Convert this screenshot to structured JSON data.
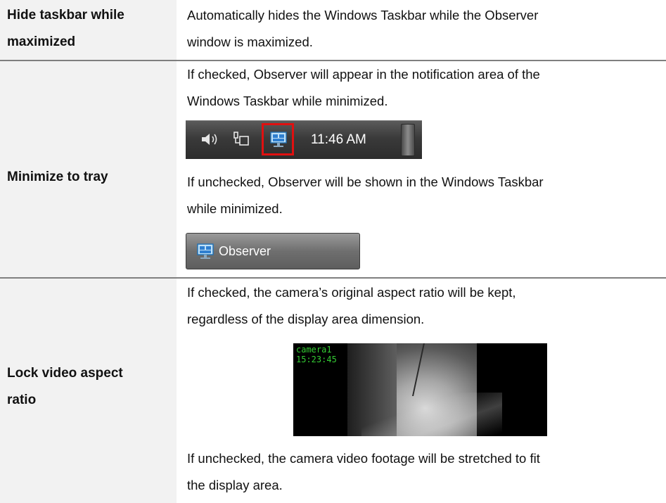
{
  "rows": [
    {
      "label_lines": [
        "Hide taskbar while",
        "maximized"
      ],
      "desc_lines": [
        "Automatically hides the Windows Taskbar while the Observer",
        "window is maximized."
      ]
    },
    {
      "label_lines": [
        "Minimize to tray"
      ],
      "desc_checked_lines": [
        "If checked, Observer will appear in the notification area of the",
        "Windows Taskbar while minimized."
      ],
      "tray_image": {
        "time": "11:46 AM",
        "icons": [
          "speaker-icon",
          "network-icon",
          "observer-tray-icon"
        ]
      },
      "desc_unchecked_lines": [
        "If unchecked, Observer will be shown in the Windows Taskbar",
        "while minimized."
      ],
      "taskbar_button": {
        "label": "Observer",
        "icon": "observer-icon"
      }
    },
    {
      "label_lines": [
        "Lock video aspect",
        "ratio"
      ],
      "desc_checked_lines": [
        "If checked, the camera’s original aspect ratio will be kept,",
        "regardless of the display area dimension."
      ],
      "camera_overlay": [
        "camera1",
        "15:23:45"
      ],
      "desc_unchecked_lines": [
        "If unchecked, the camera video footage will be stretched to fit",
        "the display area."
      ]
    }
  ],
  "colors": {
    "highlight_box": "#e01010",
    "label_bg": "#f2f2f2",
    "divider": "#7f7f7f",
    "overlay_text": "#33cc33"
  }
}
